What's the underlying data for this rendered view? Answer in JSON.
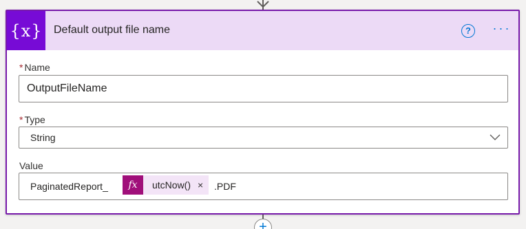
{
  "card": {
    "title": "Default output file name",
    "icon": "variable-icon",
    "icon_text": "{x}",
    "accent_color": "#770bd6",
    "header_color": "#ecdaf6",
    "help_symbol": "?",
    "more_symbol": "···"
  },
  "fields": {
    "name": {
      "required_mark": "*",
      "label": "Name",
      "value": "OutputFileName"
    },
    "type": {
      "required_mark": "*",
      "label": "Type",
      "selected": "String"
    },
    "value": {
      "label": "Value",
      "prefix": "PaginatedReport_",
      "token": {
        "icon_text": "fx",
        "label": "utcNow()",
        "remove": "×",
        "color": "#a00f7a"
      },
      "suffix": ".PDF"
    }
  },
  "add_step": {
    "symbol": "+"
  }
}
